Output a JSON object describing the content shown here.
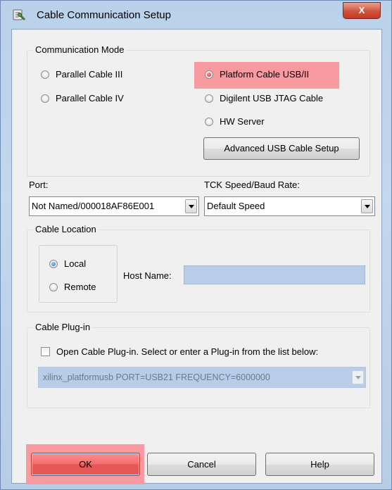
{
  "window": {
    "title": "Cable Communication Setup",
    "close_glyph": "X"
  },
  "communication_mode": {
    "legend": "Communication Mode",
    "options_left": [
      "Parallel Cable III",
      "Parallel Cable IV"
    ],
    "options_right": [
      "Platform Cable USB/II",
      "Digilent USB JTAG Cable",
      "HW Server"
    ],
    "selected": "Platform Cable USB/II",
    "advanced_button": "Advanced USB Cable Setup"
  },
  "port": {
    "label": "Port:",
    "value": "Not Named/000018AF86E001"
  },
  "tck": {
    "label": "TCK Speed/Baud Rate:",
    "value": "Default Speed"
  },
  "cable_location": {
    "legend": "Cable Location",
    "options": [
      "Local",
      "Remote"
    ],
    "selected": "Local",
    "host_label": "Host Name:",
    "host_value": ""
  },
  "cable_plugin": {
    "legend": "Cable Plug-in",
    "checkbox_label": "Open Cable Plug-in. Select or enter a Plug-in from the list below:",
    "checked": false,
    "value": "xilinx_platformusb PORT=USB21 FREQUENCY=6000000"
  },
  "buttons": {
    "ok": "OK",
    "cancel": "Cancel",
    "help": "Help"
  },
  "colors": {
    "highlight": "#f89a9f",
    "titlebar": "#b9d1ea",
    "close": "#c23a22"
  }
}
